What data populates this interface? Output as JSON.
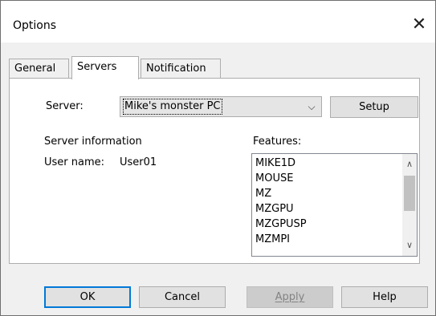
{
  "window": {
    "title": "Options",
    "close_glyph": "✕"
  },
  "tabs": [
    {
      "label": "General",
      "active": false
    },
    {
      "label": "Servers",
      "active": true
    },
    {
      "label": "Notification",
      "active": false
    }
  ],
  "server": {
    "label": "Server:",
    "selected": "Mike's monster PC",
    "setup_label": "Setup"
  },
  "server_info": {
    "heading": "Server information",
    "user_label": "User name:",
    "user_value": "User01"
  },
  "features": {
    "label": "Features:",
    "items": [
      "MIKE1D",
      "MOUSE",
      "MZ",
      "MZGPU",
      "MZGPUSP",
      "MZMPI"
    ]
  },
  "footer": {
    "ok": "OK",
    "cancel": "Cancel",
    "apply": "Apply",
    "help": "Help"
  },
  "colors": {
    "accent": "#0078d7",
    "dialog_bg": "#f0f0f0"
  }
}
